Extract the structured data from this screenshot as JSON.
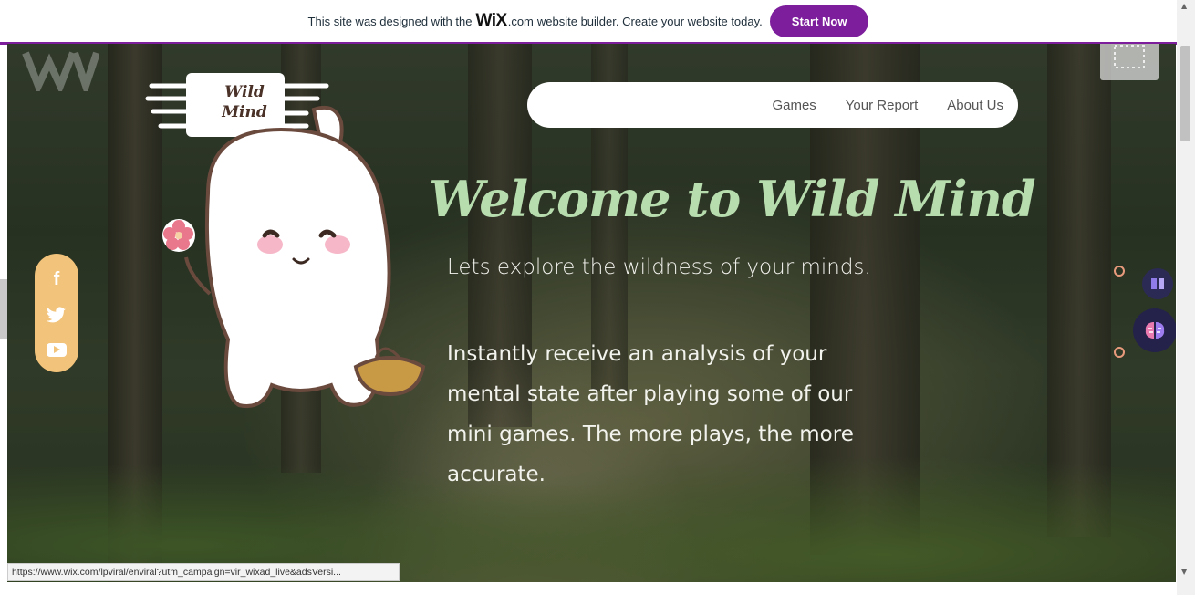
{
  "wix_banner": {
    "text_before": "This site was designed with the",
    "logo": "WiX",
    "logo_suffix": ".com",
    "text_after": "website builder. Create your website today.",
    "cta": "Start Now"
  },
  "nav": {
    "items": [
      "Games",
      "Your Report",
      "About Us"
    ]
  },
  "mascot": {
    "sign_text_line1": "Wild",
    "sign_text_line2": "Mind"
  },
  "hero": {
    "title": "Welcome to Wild Mind",
    "subtitle": "Lets explore the wildness of your minds.",
    "body": "Instantly receive an analysis of your mental state after playing some of our mini games. The more plays, the more accurate."
  },
  "social": {
    "icons": [
      "facebook-icon",
      "twitter-icon",
      "youtube-icon"
    ],
    "facebook_glyph": "f",
    "color": "#f2c37a"
  },
  "colors": {
    "accent_purple": "#7d1e9c",
    "title_green": "#b7dcae",
    "dot_orange": "#e89a7c"
  },
  "status_bar": {
    "url": "https://www.wix.com/lpviral/enviral?utm_campaign=vir_wixad_live&adsVersi..."
  }
}
